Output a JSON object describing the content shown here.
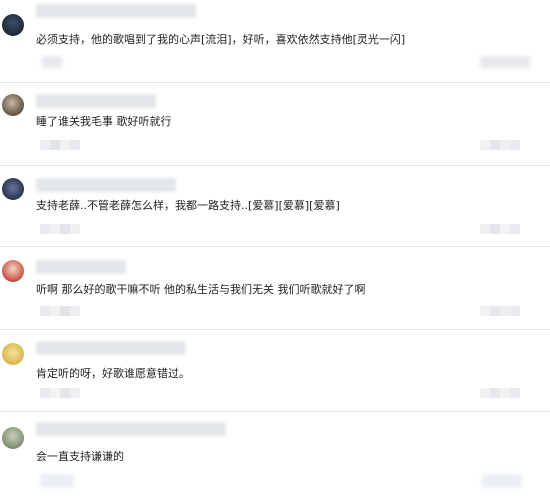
{
  "comments": [
    {
      "text": "必须支持，他的歌唱到了我的心声[流泪]，好听，喜欢依然支持他[灵光一闪]",
      "avatar_color": "#1e2a3a"
    },
    {
      "text": "睡了谁关我毛事 歌好听就行",
      "avatar_color": "#5a4a3c"
    },
    {
      "text": "支持老薛..不管老薛怎么样，我都一路支持..[爱慕][爱慕][爱慕]",
      "avatar_color": "#2b3350"
    },
    {
      "text": "听啊 那么好的歌干嘛不听 他的私生活与我们无关 我们听歌就好了啊",
      "avatar_color": "#c4463a"
    },
    {
      "text": "肯定听的呀，好歌谁愿意错过。",
      "avatar_color": "#d8b24a"
    },
    {
      "text": "会一直支持谦谦的",
      "avatar_color": "#7a8a6a"
    }
  ],
  "colors": {
    "divider": "#e8e8e8",
    "blur": "#e3e6ea",
    "text": "#222222"
  }
}
